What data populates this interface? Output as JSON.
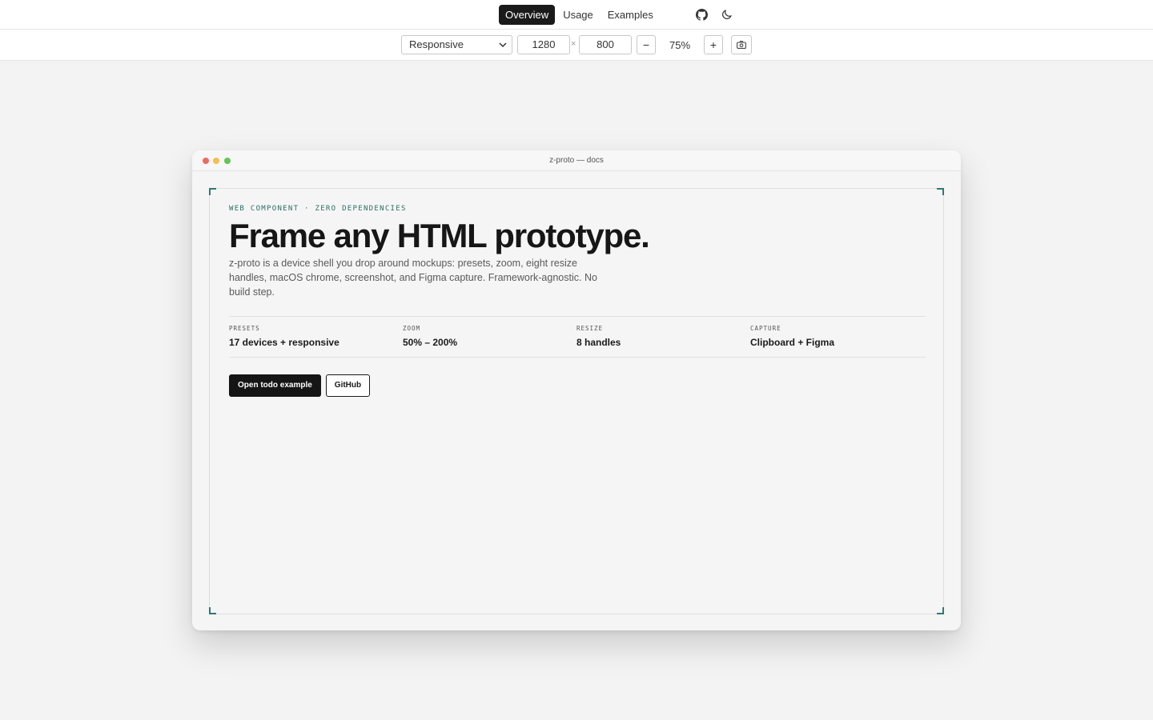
{
  "nav": {
    "tabs": [
      {
        "label": "Overview",
        "active": true
      },
      {
        "label": "Usage",
        "active": false
      },
      {
        "label": "Examples",
        "active": false
      }
    ],
    "icons": [
      "github-icon",
      "moon-icon"
    ]
  },
  "toolbar": {
    "device_select": "Responsive",
    "width": "1280",
    "times": "×",
    "height": "800",
    "zoom_out": "−",
    "zoom": "75%",
    "zoom_in": "+",
    "screenshot_icon": "camera-icon"
  },
  "window": {
    "title": "z-proto — docs",
    "traffic_lights": {
      "close": "#ee6a5f",
      "minimize": "#f5be4f",
      "maximize": "#62c554"
    },
    "accent": "#2b7a78"
  },
  "hero": {
    "eyebrow": "WEB COMPONENT · ZERO DEPENDENCIES",
    "headline": "Frame any HTML prototype.",
    "lede": "z-proto is a device shell you drop around mockups: presets, zoom, eight resize handles, macOS chrome, screenshot, and Figma capture. Framework-agnostic. No build step."
  },
  "stats": [
    {
      "key": "PRESETS",
      "value": "17 devices + responsive"
    },
    {
      "key": "ZOOM",
      "value": "50% – 200%"
    },
    {
      "key": "RESIZE",
      "value": "8 handles"
    },
    {
      "key": "CAPTURE",
      "value": "Clipboard + Figma"
    }
  ],
  "cta": {
    "primary": "Open todo example",
    "secondary": "GitHub"
  }
}
